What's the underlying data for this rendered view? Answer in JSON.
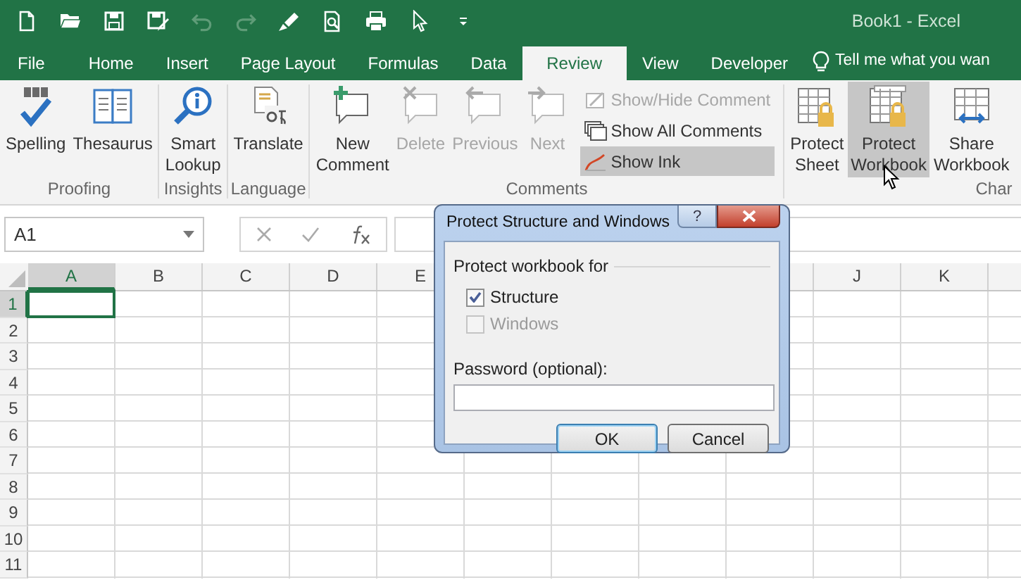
{
  "window": {
    "title": "Book1 - Excel"
  },
  "quick_access": [
    {
      "kind": "new",
      "disabled": false
    },
    {
      "kind": "open",
      "disabled": false
    },
    {
      "kind": "save",
      "disabled": false
    },
    {
      "kind": "saveas",
      "disabled": false
    },
    {
      "kind": "undo",
      "disabled": true
    },
    {
      "kind": "redo",
      "disabled": true
    },
    {
      "kind": "brush",
      "disabled": false
    },
    {
      "kind": "preview",
      "disabled": false
    },
    {
      "kind": "print",
      "disabled": false
    },
    {
      "kind": "pointer",
      "disabled": false
    },
    {
      "kind": "customize",
      "disabled": false
    }
  ],
  "tabs": [
    {
      "label": "File",
      "selected": false
    },
    {
      "label": "Home",
      "selected": false
    },
    {
      "label": "Insert",
      "selected": false
    },
    {
      "label": "Page Layout",
      "selected": false
    },
    {
      "label": "Formulas",
      "selected": false
    },
    {
      "label": "Data",
      "selected": false
    },
    {
      "label": "Review",
      "selected": true
    },
    {
      "label": "View",
      "selected": false
    },
    {
      "label": "Developer",
      "selected": false
    }
  ],
  "tell_me": {
    "text": "Tell me what you wan"
  },
  "ribbon_groups": [
    {
      "label": "Proofing",
      "commands": [
        {
          "kind": "spelling",
          "lines": [
            "Spelling"
          ],
          "disabled": false,
          "highlighted": false
        },
        {
          "kind": "thesaurus",
          "lines": [
            "Thesaurus"
          ],
          "disabled": false,
          "highlighted": false
        }
      ]
    },
    {
      "label": "Insights",
      "commands": [
        {
          "kind": "smart",
          "lines": [
            "Smart",
            "Lookup"
          ],
          "disabled": false,
          "highlighted": false
        }
      ]
    },
    {
      "label": "Language",
      "commands": [
        {
          "kind": "translate",
          "lines": [
            "Translate"
          ],
          "disabled": false,
          "highlighted": false
        }
      ]
    },
    {
      "label": "Comments",
      "commands": [
        {
          "kind": "newcomment",
          "lines": [
            "New",
            "Comment"
          ],
          "disabled": false,
          "highlighted": false
        },
        {
          "kind": "delcomment",
          "lines": [
            "Delete"
          ],
          "disabled": true,
          "highlighted": false
        },
        {
          "kind": "prevcomment",
          "lines": [
            "Previous"
          ],
          "disabled": true,
          "highlighted": false
        },
        {
          "kind": "nextcomment",
          "lines": [
            "Next"
          ],
          "disabled": true,
          "highlighted": false
        }
      ],
      "small_commands": [
        {
          "kind": "showhide",
          "label": "Show/Hide Comment",
          "disabled": true,
          "on": false
        },
        {
          "kind": "showall",
          "label": "Show All Comments",
          "disabled": false,
          "on": false
        },
        {
          "kind": "showink",
          "label": "Show Ink",
          "disabled": false,
          "on": true
        }
      ]
    },
    {
      "label": "Char",
      "commands": [
        {
          "kind": "protectsheet",
          "lines": [
            "Protect",
            "Sheet"
          ],
          "disabled": false,
          "highlighted": false
        },
        {
          "kind": "protectbook",
          "lines": [
            "Protect",
            "Workbook"
          ],
          "disabled": false,
          "highlighted": true
        },
        {
          "kind": "sharebook",
          "lines": [
            "Share",
            "Workbook"
          ],
          "disabled": false,
          "highlighted": false
        }
      ]
    }
  ],
  "formula_bar": {
    "name_box": "A1"
  },
  "sheet": {
    "columns": [
      {
        "label": "A",
        "selected": true
      },
      {
        "label": "B",
        "selected": false
      },
      {
        "label": "C",
        "selected": false
      },
      {
        "label": "D",
        "selected": false
      },
      {
        "label": "E",
        "selected": false
      },
      {
        "label": "J",
        "selected": false
      },
      {
        "label": "K",
        "selected": false
      }
    ],
    "rows": [
      {
        "label": "1",
        "selected": true
      },
      {
        "label": "2",
        "selected": false
      },
      {
        "label": "3",
        "selected": false
      },
      {
        "label": "4",
        "selected": false
      },
      {
        "label": "5",
        "selected": false
      },
      {
        "label": "6",
        "selected": false
      },
      {
        "label": "7",
        "selected": false
      },
      {
        "label": "8",
        "selected": false
      },
      {
        "label": "9",
        "selected": false
      },
      {
        "label": "10",
        "selected": false
      },
      {
        "label": "11",
        "selected": false
      }
    ]
  },
  "dialog": {
    "title": "Protect Structure and Windows",
    "help": "?",
    "group_label": "Protect workbook for",
    "options": [
      {
        "label": "Structure",
        "checked": true,
        "disabled": false
      },
      {
        "label": "Windows",
        "checked": false,
        "disabled": true
      }
    ],
    "password_label": "Password (optional):",
    "buttons": [
      {
        "label": "OK",
        "default": true
      },
      {
        "label": "Cancel",
        "default": false
      }
    ]
  }
}
